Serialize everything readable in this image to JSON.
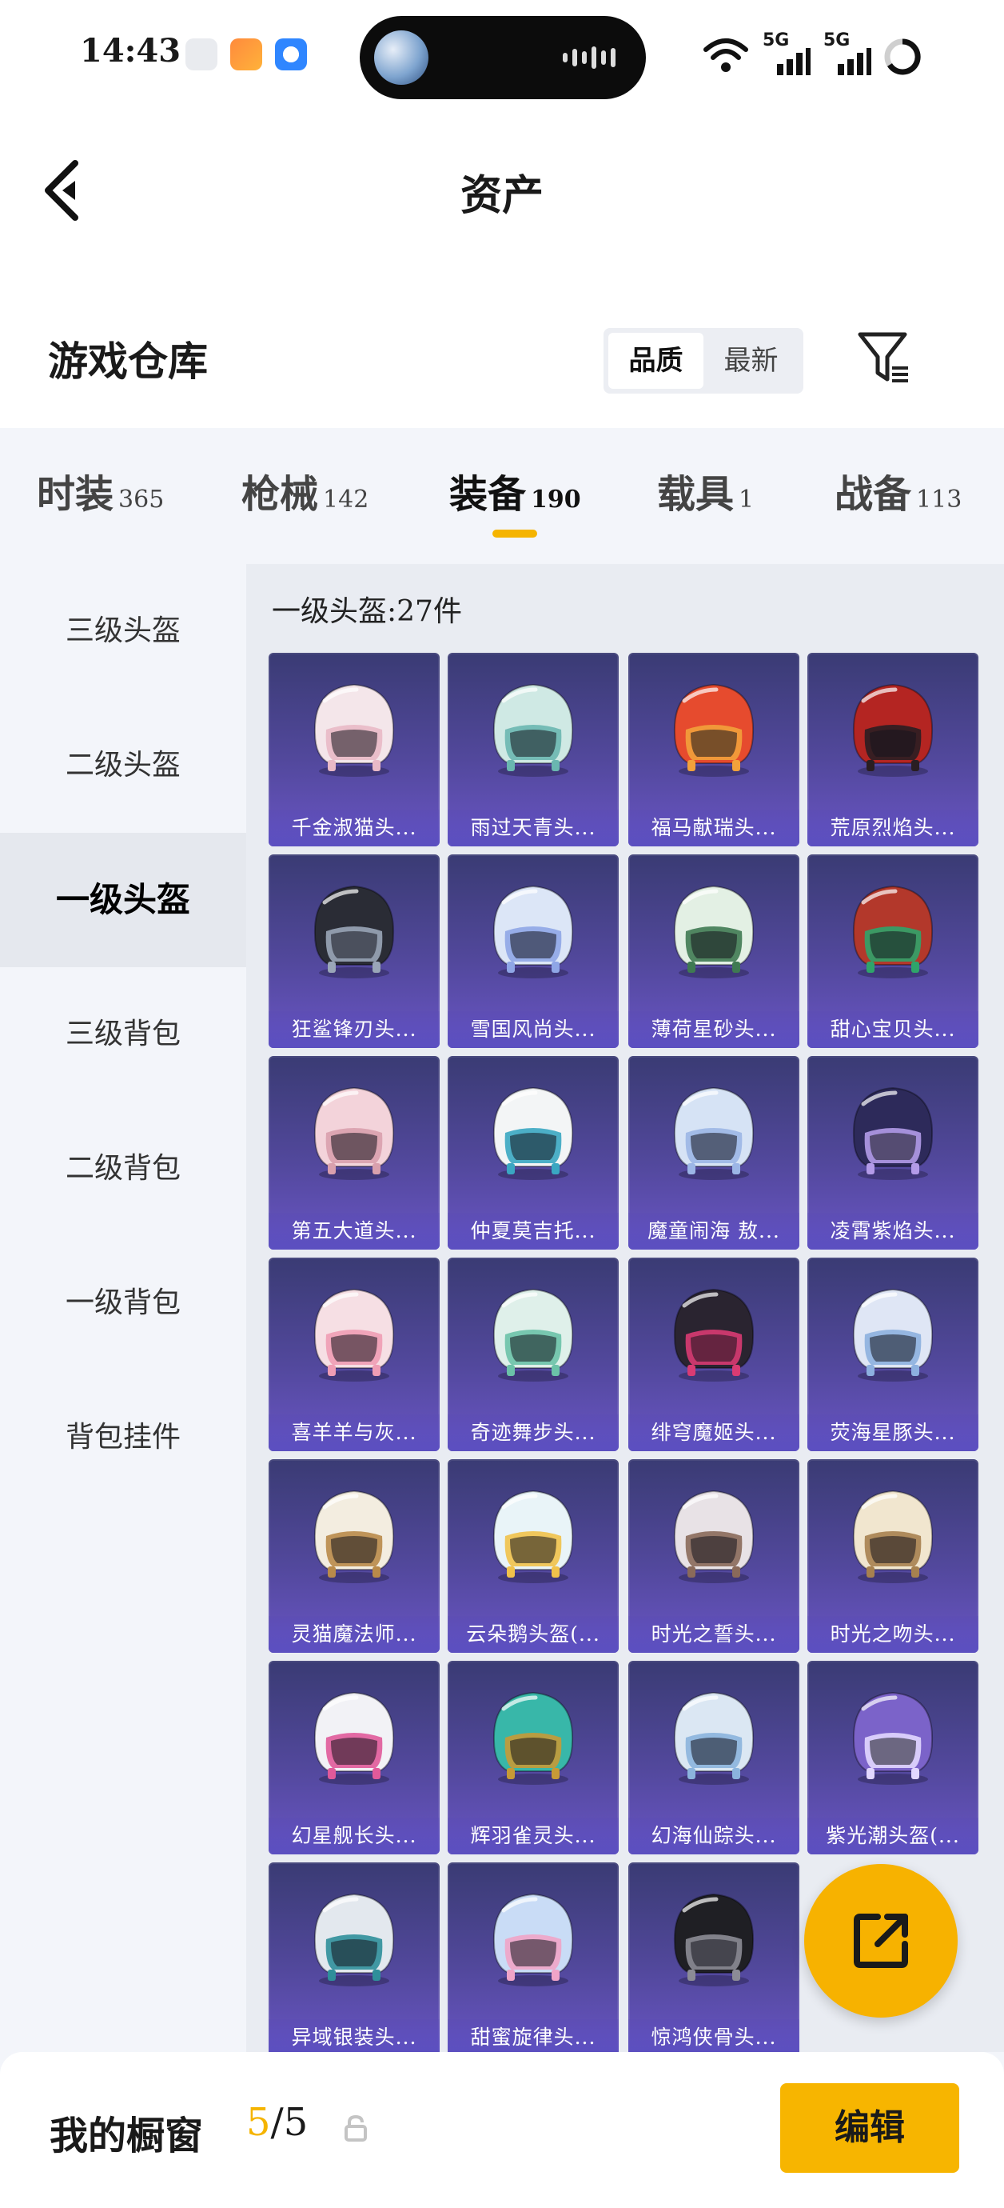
{
  "status_bar": {
    "time": "14:43",
    "network_1": "5G",
    "network_2": "5G"
  },
  "header": {
    "title": "资产"
  },
  "section": {
    "title": "游戏仓库",
    "sort_options": [
      "品质",
      "最新"
    ],
    "sort_selected": "品质"
  },
  "tabs": [
    {
      "label": "时装",
      "count": "365"
    },
    {
      "label": "枪械",
      "count": "142"
    },
    {
      "label": "装备",
      "count": "190"
    },
    {
      "label": "载具",
      "count": "1"
    },
    {
      "label": "战备",
      "count": "113"
    }
  ],
  "active_tab": "装备",
  "sidebar": {
    "items": [
      {
        "label": "三级头盔"
      },
      {
        "label": "二级头盔"
      },
      {
        "label": "一级头盔"
      },
      {
        "label": "三级背包"
      },
      {
        "label": "二级背包"
      },
      {
        "label": "一级背包"
      },
      {
        "label": "背包挂件"
      }
    ],
    "selected": "一级头盔"
  },
  "grid": {
    "title": "一级头盔:27件",
    "items": [
      {
        "name": "千金淑猫头...",
        "color": "#f4e6ea",
        "accent": "#e9b9c7"
      },
      {
        "name": "雨过天青头...",
        "color": "#cfe9e4",
        "accent": "#6ab7b0"
      },
      {
        "name": "福马献瑞头...",
        "color": "#e64b2e",
        "accent": "#f2a13b"
      },
      {
        "name": "荒原烈焰头...",
        "color": "#b42522",
        "accent": "#2a1e22"
      },
      {
        "name": "狂鲨锋刃头...",
        "color": "#2a2c35",
        "accent": "#9aa6b8"
      },
      {
        "name": "雪国风尚头...",
        "color": "#dce6f7",
        "accent": "#8fa6e6"
      },
      {
        "name": "薄荷星砂头...",
        "color": "#e3f0e4",
        "accent": "#3f7a52"
      },
      {
        "name": "甜心宝贝头...",
        "color": "#b3382b",
        "accent": "#2fa46a"
      },
      {
        "name": "第五大道头...",
        "color": "#f3d3da",
        "accent": "#d9a0ad"
      },
      {
        "name": "仲夏莫吉托...",
        "color": "#f3f5f6",
        "accent": "#3aa7c2"
      },
      {
        "name": "魔童闹海 敖...",
        "color": "#d6e3f5",
        "accent": "#9cb6e6"
      },
      {
        "name": "凌霄紫焰头...",
        "color": "#2d2a5a",
        "accent": "#b39be8"
      },
      {
        "name": "喜羊羊与灰...",
        "color": "#f6dfe4",
        "accent": "#ef9db4"
      },
      {
        "name": "奇迹舞步头...",
        "color": "#dff0ea",
        "accent": "#6bc2a8"
      },
      {
        "name": "绯穹魔姬头...",
        "color": "#2a2430",
        "accent": "#d93b73"
      },
      {
        "name": "荧海星豚头...",
        "color": "#dfe6f5",
        "accent": "#8db0df"
      },
      {
        "name": "灵猫魔法师...",
        "color": "#f3ede0",
        "accent": "#b98a4a"
      },
      {
        "name": "云朵鹅头盔(...",
        "color": "#e9f4f8",
        "accent": "#f1c24a"
      },
      {
        "name": "时光之誓头...",
        "color": "#e8e2e6",
        "accent": "#8a6a5a"
      },
      {
        "name": "时光之吻头...",
        "color": "#f1e6cf",
        "accent": "#a7814f"
      },
      {
        "name": "幻星舰长头...",
        "color": "#f2f2f6",
        "accent": "#e05a9a"
      },
      {
        "name": "辉羽雀灵头...",
        "color": "#38b7a9",
        "accent": "#c79a36"
      },
      {
        "name": "幻海仙踪头...",
        "color": "#dbe7f3",
        "accent": "#8bb4dd"
      },
      {
        "name": "紫光潮头盔(...",
        "color": "#7b63c9",
        "accent": "#e2d7ff"
      },
      {
        "name": "异域银装头...",
        "color": "#e3e8ee",
        "accent": "#2f8f9a"
      },
      {
        "name": "甜蜜旋律头...",
        "color": "#c9dcf6",
        "accent": "#f0a4c8"
      },
      {
        "name": "惊鸿侠骨头...",
        "color": "#1f1f24",
        "accent": "#8c8c96"
      }
    ]
  },
  "bottom_bar": {
    "label": "我的橱窗",
    "current": "5",
    "total": "/5",
    "edit_label": "编辑"
  },
  "colors": {
    "accent": "#f5b400",
    "card_top": "#3a3b74",
    "card_bottom": "#6955c4"
  }
}
